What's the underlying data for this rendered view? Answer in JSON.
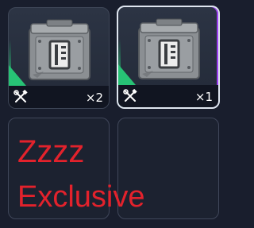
{
  "inventory": {
    "slots": [
      {
        "item_icon": "metal-crate-icon",
        "action_icon": "wrench-screwdriver-icon",
        "count": "×2",
        "rarity_color": "#27c275",
        "selected": false
      },
      {
        "item_icon": "metal-crate-icon",
        "action_icon": "wrench-screwdriver-icon",
        "count": "×1",
        "rarity_color": "#27c275",
        "selected": true
      },
      {
        "empty": true
      },
      {
        "empty": true
      }
    ]
  },
  "overlay": {
    "line1": "Zzzz",
    "line2": "Exclusive",
    "color": "#e3222c"
  },
  "colors": {
    "background": "#191e2d",
    "selection_border": "#dfe6f0",
    "selection_accent": "#9a3cf0"
  }
}
